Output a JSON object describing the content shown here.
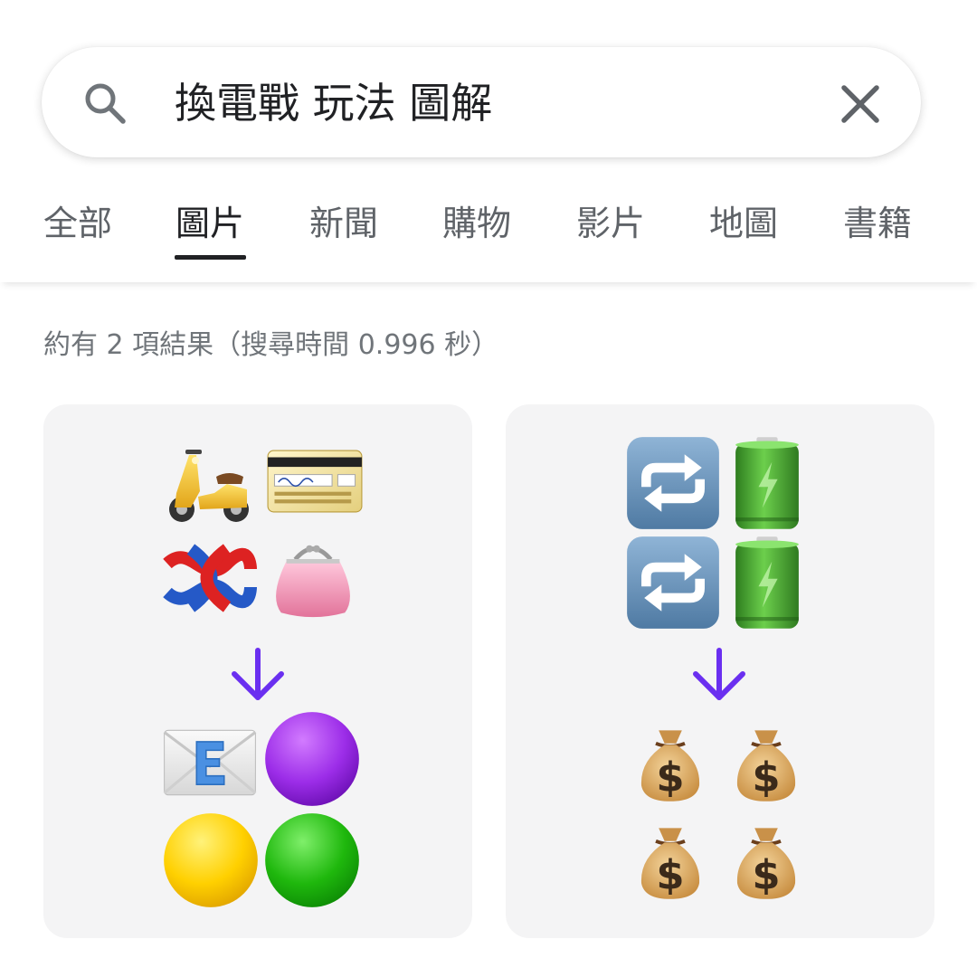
{
  "search": {
    "query": "換電戰 玩法 圖解",
    "icon": "search-icon",
    "clear_icon": "close-icon"
  },
  "tabs": [
    {
      "label": "全部",
      "active": false
    },
    {
      "label": "圖片",
      "active": true
    },
    {
      "label": "新聞",
      "active": false
    },
    {
      "label": "購物",
      "active": false
    },
    {
      "label": "影片",
      "active": false
    },
    {
      "label": "地圖",
      "active": false
    },
    {
      "label": "書籍",
      "active": false
    }
  ],
  "results": {
    "stats": "約有 2 項結果（搜尋時間 0.996 秒）"
  },
  "images": [
    {
      "top_emojis": [
        "motor-scooter",
        "credit-card",
        "knot",
        "purse"
      ],
      "arrow": "down-arrow",
      "bottom_emojis": [
        "e-mail-envelope",
        "purple-circle",
        "yellow-circle",
        "green-circle"
      ]
    },
    {
      "top_emojis": [
        "repeat-button",
        "battery",
        "repeat-button",
        "battery"
      ],
      "arrow": "down-arrow",
      "bottom_emojis": [
        "money-bag",
        "money-bag",
        "money-bag",
        "money-bag"
      ]
    }
  ],
  "colors": {
    "arrow": "#6a2ff0",
    "active_tab": "#202124",
    "inactive_tab": "#5f6368",
    "stats_text": "#70757a",
    "card_bg": "#f4f4f5"
  }
}
